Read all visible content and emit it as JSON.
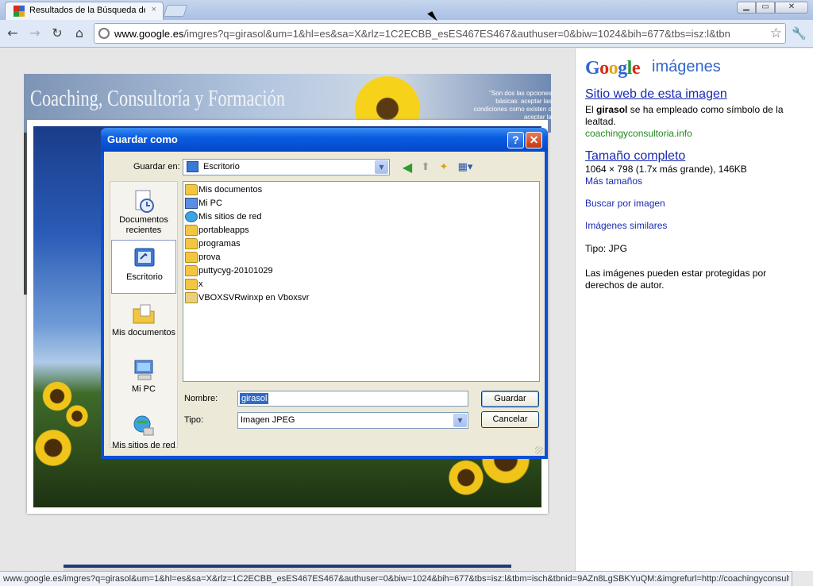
{
  "browser": {
    "tab_title": "Resultados de la Búsqueda de",
    "tab_close": "×",
    "url_host": "www.google.es",
    "url_path": "/imgres?q=girasol&um=1&hl=es&sa=X&rlz=1C2ECBB_esES467ES467&authuser=0&biw=1024&bih=677&tbs=isz:l&tbn",
    "controls": {
      "minimize": "▁",
      "maximize": "▭",
      "close": "✕"
    }
  },
  "banner": {
    "title": "Coaching, Consultoría y Formación",
    "quote": "\"Son dos las opciones básicas: aceptar las condiciones como existen o aceptar la"
  },
  "dialog": {
    "title": "Guardar como",
    "help": "?",
    "close": "✕",
    "save_in_label": "Guardar en:",
    "save_in_value": "Escritorio",
    "places": [
      {
        "label": "Documentos recientes"
      },
      {
        "label": "Escritorio"
      },
      {
        "label": "Mis documentos"
      },
      {
        "label": "Mi PC"
      },
      {
        "label": "Mis sitios de red"
      }
    ],
    "files": [
      "Mis documentos",
      "Mi PC",
      "Mis sitios de red",
      "portableapps",
      "programas",
      "prova",
      "puttycyg-20101029",
      "x",
      "VBOXSVRwinxp en Vboxsvr"
    ],
    "name_label": "Nombre:",
    "name_value": "girasol",
    "type_label": "Tipo:",
    "type_value": "Imagen JPEG",
    "save_button": "Guardar",
    "cancel_button": "Cancelar"
  },
  "panel": {
    "logo_g": [
      "G",
      "o",
      "o",
      "g",
      "l",
      "e"
    ],
    "logo_sub": "imágenes",
    "site_link": "Sitio web de esta imagen",
    "desc_pre": "El ",
    "desc_bold": "girasol",
    "desc_post": " se ha empleado como símbolo de la lealtad.",
    "site_url": "coachingyconsultoria.info",
    "fullsize_link": "Tamaño completo",
    "dimensions": "1064 × 798 (1.7x más grande), 146KB",
    "more_sizes": "Más tamaños",
    "search_by_image": "Buscar por imagen",
    "similar": "Imágenes similares",
    "type": "Tipo:  JPG",
    "copyright": "Las imágenes pueden estar protegidas por derechos de autor."
  },
  "status": "www.google.es/imgres?q=girasol&um=1&hl=es&sa=X&rlz=1C2ECBB_esES467ES467&authuser=0&biw=1024&bih=677&tbs=isz:l&tbm=isch&tbnid=9AZn8LgSBKYuQM:&imgrefurl=http://coachingyconsulto..."
}
